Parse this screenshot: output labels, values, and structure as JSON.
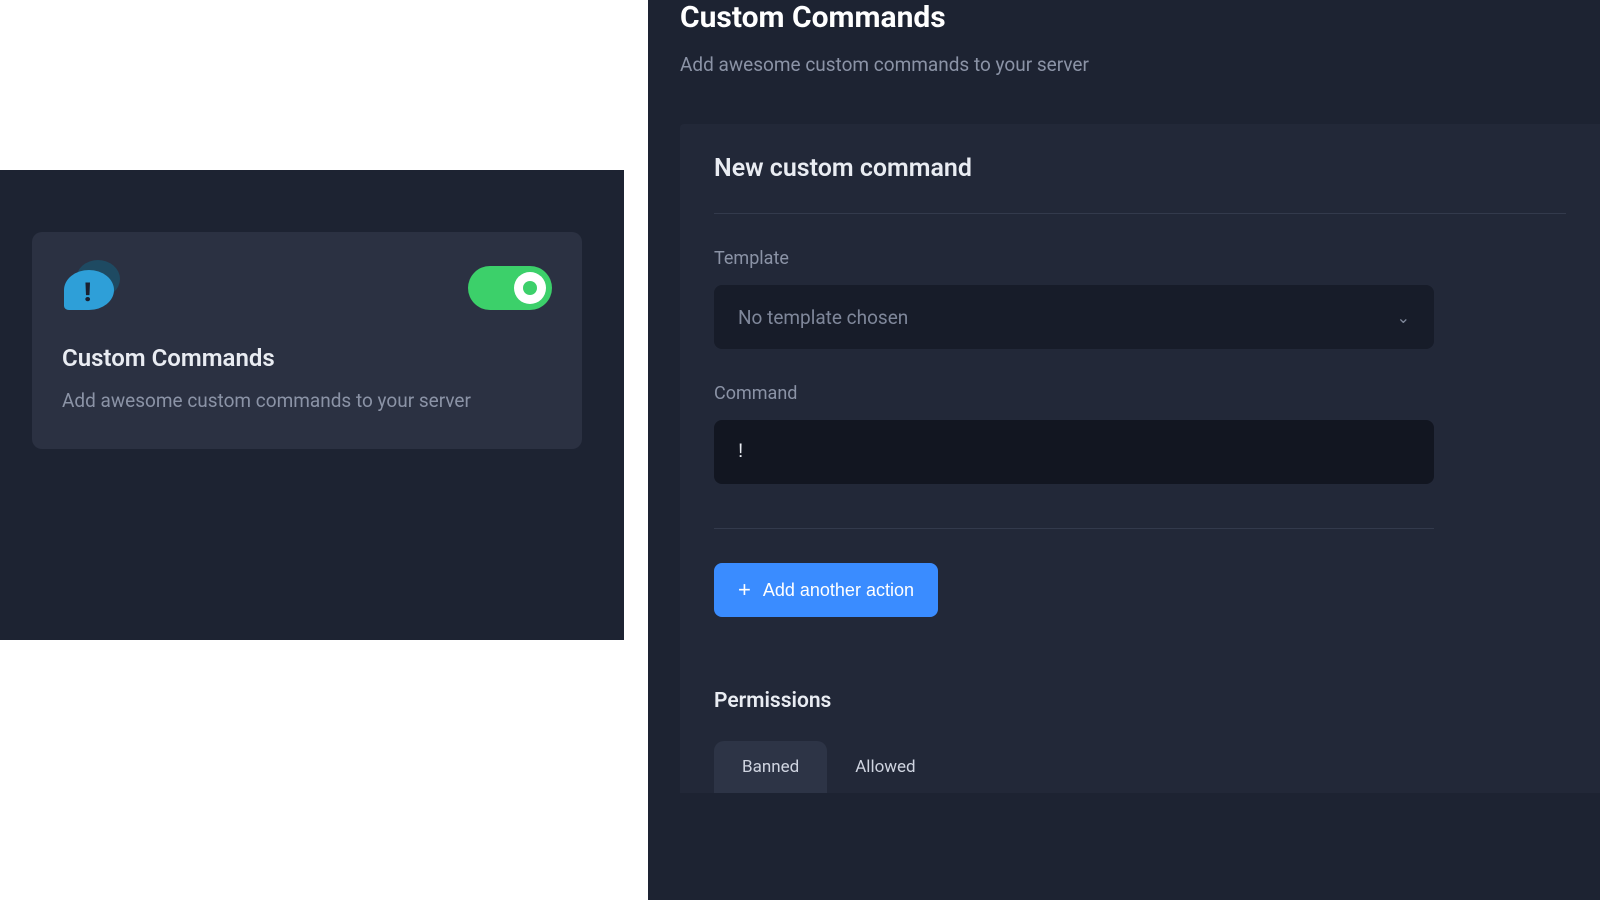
{
  "left": {
    "card": {
      "title": "Custom Commands",
      "description": "Add awesome custom commands to your server",
      "toggle_on": true
    }
  },
  "page": {
    "title": "Custom Commands",
    "subtitle": "Add awesome custom commands to your server"
  },
  "form": {
    "section_title": "New custom command",
    "template_label": "Template",
    "template_selected": "No template chosen",
    "command_label": "Command",
    "command_value": "!",
    "add_action_label": "Add another action",
    "permissions_title": "Permissions",
    "tabs": {
      "banned": "Banned",
      "allowed": "Allowed"
    }
  }
}
